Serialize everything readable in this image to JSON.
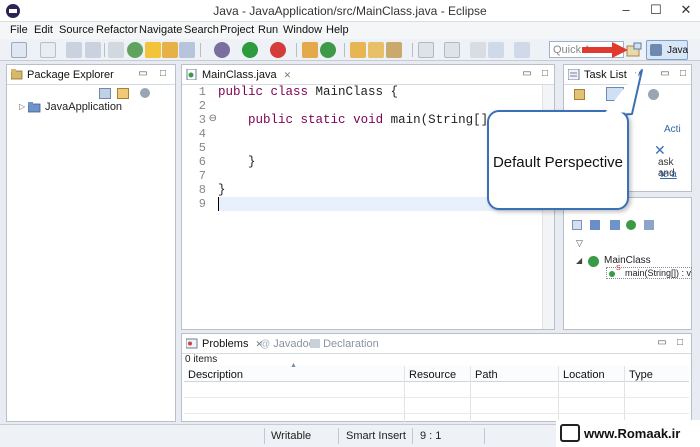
{
  "window": {
    "title": "Java - JavaApplication/src/MainClass.java - Eclipse",
    "minimize_glyph": "–",
    "maximize_glyph": "☐",
    "close_glyph": "✕"
  },
  "menu": [
    "File",
    "Edit",
    "Source",
    "Refactor",
    "Navigate",
    "Search",
    "Project",
    "Run",
    "Window",
    "Help"
  ],
  "toolbar": {
    "quick_access_placeholder": "Quick A",
    "perspective_label": "Java"
  },
  "package_explorer": {
    "tab_label": "Package Explorer",
    "project": "JavaApplication"
  },
  "editor": {
    "tab_label": "MainClass.java",
    "line_numbers": [
      "1",
      "2",
      "3",
      "4",
      "5",
      "6",
      "7",
      "8",
      "9"
    ],
    "fold_marker": "⊖"
  },
  "task_list": {
    "tab_label": "Task List",
    "partial_texts": [
      "Acti",
      "ask and",
      "te a"
    ]
  },
  "outline": {
    "class_name": "MainClass",
    "method_sig": "main(String[]) : v",
    "static_marker": "S"
  },
  "problems": {
    "tabs": [
      "Problems",
      "Javadoc",
      "Declaration"
    ],
    "items_count": "0 items",
    "columns": [
      "Description",
      "Resource",
      "Path",
      "Location",
      "Type"
    ]
  },
  "status": {
    "writable": "Writable",
    "insert_mode": "Smart Insert",
    "position": "9 : 1"
  },
  "callout": {
    "text": "Default Perspective"
  },
  "watermark": {
    "text": "www.Romaak.ir"
  },
  "colors": {
    "keyword": "#7f0055",
    "callout_border": "#3b6fb6",
    "arrow": "#e0392e",
    "selection_bg": "#d8e6f6"
  }
}
